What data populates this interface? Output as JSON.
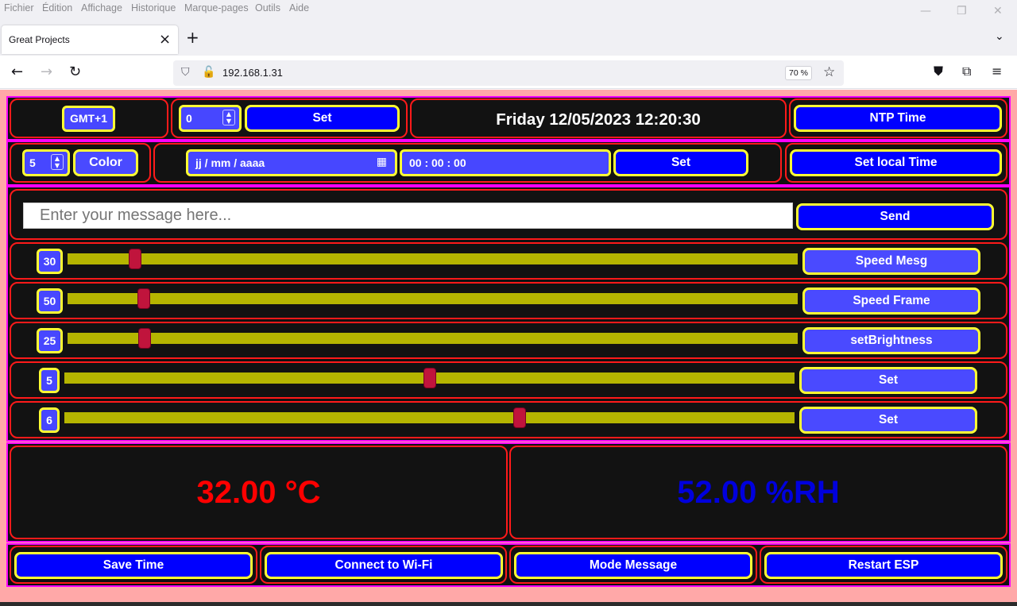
{
  "menu": [
    "Fichier",
    "Édition",
    "Affichage",
    "Historique",
    "Marque-pages",
    "Outils",
    "Aide"
  ],
  "tab": {
    "title": "Great Projects"
  },
  "address": {
    "url": "192.168.1.31",
    "zoom": "70 %"
  },
  "row1": {
    "gmt_label": "GMT+1",
    "offset_value": "0",
    "set_label": "Set",
    "datetime": "Friday 12/05/2023 12:20:30",
    "ntp_label": "NTP Time"
  },
  "row2": {
    "color_value": "5",
    "color_label": "Color",
    "date_placeholder": "jj / mm / aaaa",
    "time_value": "00 : 00 : 00",
    "set_label": "Set",
    "set_local_label": "Set local Time"
  },
  "message": {
    "placeholder": "Enter your message here...",
    "send_label": "Send"
  },
  "sliders": [
    {
      "value": "30",
      "label": "Speed Mesg",
      "fill": 0.093
    },
    {
      "value": "50",
      "label": "Speed Frame",
      "fill": 0.105
    },
    {
      "value": "25",
      "label": "setBrightness",
      "fill": 0.106
    },
    {
      "value": "5",
      "label": "Set",
      "fill": 0.5
    },
    {
      "value": "6",
      "label": "Set",
      "fill": 0.623
    }
  ],
  "readings": {
    "temperature": "32.00 °C",
    "humidity": "52.00 %RH",
    "temperature_color": "#ff0000",
    "humidity_color": "#0000dd"
  },
  "actions": {
    "save_time": "Save Time",
    "connect_wifi": "Connect to Wi-Fi",
    "mode_message": "Mode Message",
    "restart": "Restart ESP"
  },
  "colors": {
    "panel_border": "#ff00ff",
    "box_border": "#ff1a1a",
    "button": "#0000ff",
    "button_border": "#ffff33",
    "slider_track": "#b5b500",
    "slider_thumb": "#c0143c",
    "page_bg": "#ffa8a8"
  },
  "icons": [
    "back-arrow-icon",
    "forward-arrow-icon",
    "reload-icon",
    "shield-icon",
    "insecure-lock-icon",
    "bookmark-star-icon",
    "pocket-icon",
    "extensions-icon",
    "hamburger-menu-icon",
    "calendar-icon",
    "spinner-icon"
  ]
}
